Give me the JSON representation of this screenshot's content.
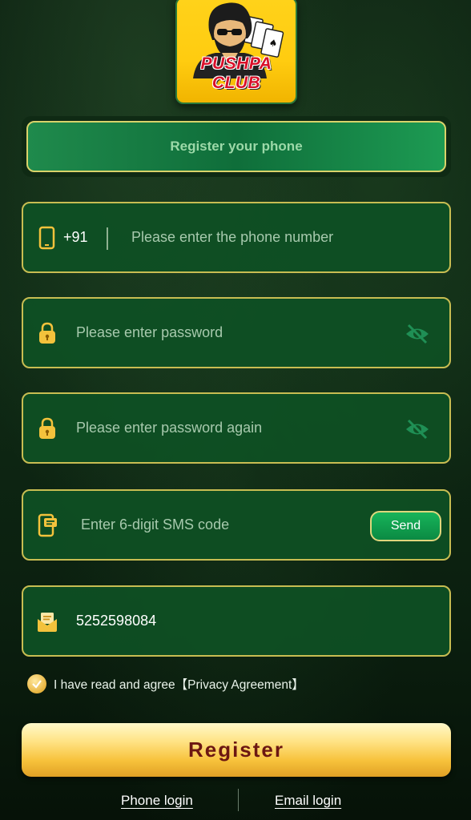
{
  "logo": {
    "text": "PUSHPA CLUB"
  },
  "banner": {
    "title": "Register your phone"
  },
  "phone_field": {
    "country_code": "+91",
    "placeholder": "Please enter the phone number"
  },
  "password_field": {
    "placeholder": "Please enter password"
  },
  "password_again_field": {
    "placeholder": "Please enter password again"
  },
  "sms_field": {
    "placeholder": "Enter 6-digit SMS code",
    "send_label": "Send"
  },
  "invite_field": {
    "value": "5252598084"
  },
  "agreement": {
    "text": "I have read and agree【Privacy Agreement】"
  },
  "register_button": {
    "label": "Register"
  },
  "bottom_links": {
    "phone_login": "Phone login",
    "email_login": "Email login"
  },
  "colors": {
    "field_border": "#c8bd52",
    "field_bg": "#0e5024",
    "register_text": "#6c1712",
    "send_bg": "#17b45a"
  },
  "icons": [
    "phone-icon",
    "lock-icon",
    "eye-off-icon",
    "sms-icon",
    "mail-icon",
    "checkmark-icon"
  ]
}
